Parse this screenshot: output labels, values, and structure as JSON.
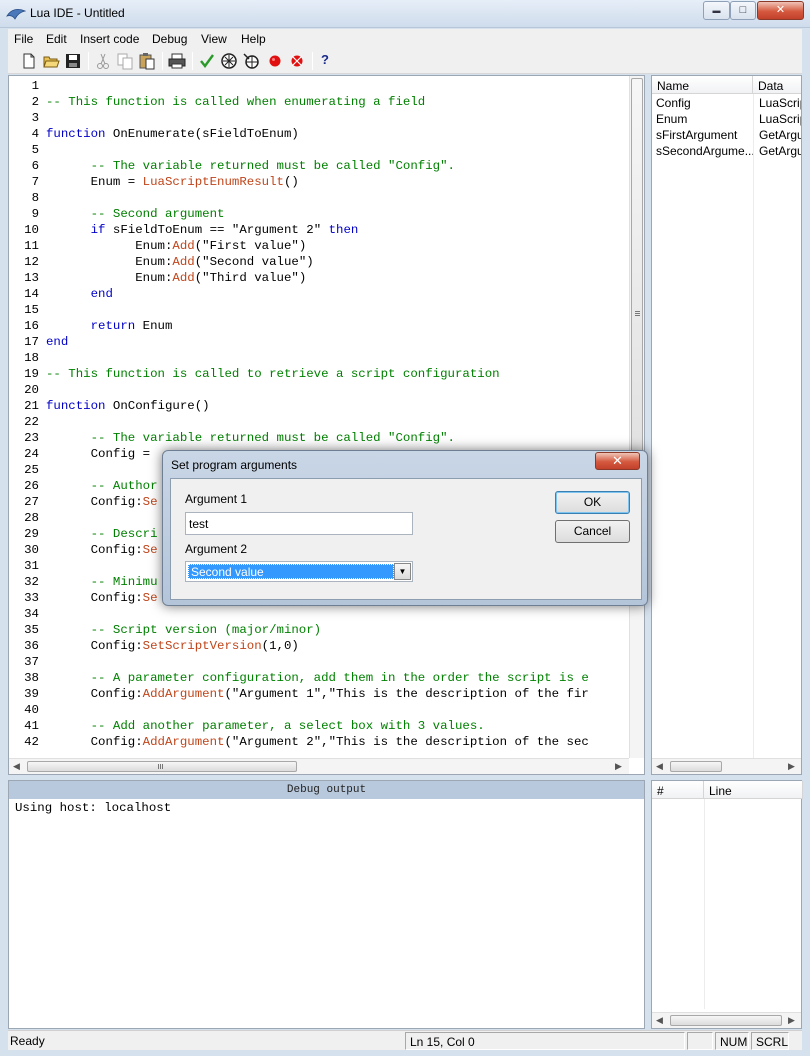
{
  "window": {
    "title": "Lua IDE - Untitled",
    "minimize_glyph": "▬",
    "maximize_glyph": "□",
    "close_glyph": "✕"
  },
  "menu": [
    "File",
    "Edit",
    "Insert code",
    "Debug",
    "View",
    "Help"
  ],
  "toolbar": {
    "icons": [
      "new-file-icon",
      "open-folder-icon",
      "save-icon",
      "cut-icon",
      "copy-icon",
      "paste-icon",
      "print-icon",
      "check-syntax-icon",
      "run-icon",
      "step-icon",
      "breakpoint-icon",
      "clear-breakpoints-icon",
      "help-icon"
    ],
    "help_glyph": "?"
  },
  "editor": {
    "lines": [
      {
        "n": "1",
        "text": "",
        "tokens": []
      },
      {
        "n": "2",
        "tokens": [
          [
            "-- This function is called when enumerating a field",
            "cm"
          ]
        ]
      },
      {
        "n": "3",
        "tokens": []
      },
      {
        "n": "4",
        "tokens": [
          [
            "function",
            "kw"
          ],
          [
            " OnEnumerate(sFieldToEnum)",
            ""
          ]
        ]
      },
      {
        "n": "5",
        "tokens": []
      },
      {
        "n": "6",
        "tokens": [
          [
            "      -- The variable returned must be called \"Config\".",
            "cm"
          ]
        ]
      },
      {
        "n": "7",
        "tokens": [
          [
            "      Enum = ",
            ""
          ],
          [
            "LuaScriptEnumResult",
            "fn"
          ],
          [
            "()",
            ""
          ]
        ]
      },
      {
        "n": "8",
        "tokens": []
      },
      {
        "n": "9",
        "tokens": [
          [
            "      -- Second argument",
            "cm"
          ]
        ]
      },
      {
        "n": "10",
        "tokens": [
          [
            "      ",
            ""
          ],
          [
            "if",
            "kw"
          ],
          [
            " sFieldToEnum == \"Argument 2\" ",
            ""
          ],
          [
            "then",
            "kw"
          ]
        ]
      },
      {
        "n": "11",
        "tokens": [
          [
            "            Enum:",
            ""
          ],
          [
            "Add",
            "fn"
          ],
          [
            "(\"First value\")",
            ""
          ]
        ]
      },
      {
        "n": "12",
        "tokens": [
          [
            "            Enum:",
            ""
          ],
          [
            "Add",
            "fn"
          ],
          [
            "(\"Second value\")",
            ""
          ]
        ]
      },
      {
        "n": "13",
        "tokens": [
          [
            "            Enum:",
            ""
          ],
          [
            "Add",
            "fn"
          ],
          [
            "(\"Third value\")",
            ""
          ]
        ]
      },
      {
        "n": "14",
        "tokens": [
          [
            "      ",
            ""
          ],
          [
            "end",
            "kw"
          ]
        ]
      },
      {
        "n": "15",
        "tokens": []
      },
      {
        "n": "16",
        "tokens": [
          [
            "      ",
            ""
          ],
          [
            "return",
            "kw"
          ],
          [
            " Enum",
            ""
          ]
        ]
      },
      {
        "n": "17",
        "tokens": [
          [
            "end",
            "kw"
          ]
        ]
      },
      {
        "n": "18",
        "tokens": []
      },
      {
        "n": "19",
        "tokens": [
          [
            "-- This function is called to retrieve a script configuration",
            "cm"
          ]
        ]
      },
      {
        "n": "20",
        "tokens": []
      },
      {
        "n": "21",
        "tokens": [
          [
            "function",
            "kw"
          ],
          [
            " OnConfigure()",
            ""
          ]
        ]
      },
      {
        "n": "22",
        "tokens": []
      },
      {
        "n": "23",
        "tokens": [
          [
            "      -- The variable returned must be called \"Config\".",
            "cm"
          ]
        ]
      },
      {
        "n": "24",
        "tokens": [
          [
            "      Config = ",
            ""
          ]
        ]
      },
      {
        "n": "25",
        "tokens": []
      },
      {
        "n": "26",
        "tokens": [
          [
            "      -- Author",
            "cm"
          ]
        ]
      },
      {
        "n": "27",
        "tokens": [
          [
            "      Config:",
            ""
          ],
          [
            "Se",
            "fn"
          ]
        ]
      },
      {
        "n": "28",
        "tokens": []
      },
      {
        "n": "29",
        "tokens": [
          [
            "      -- Descri",
            "cm"
          ]
        ]
      },
      {
        "n": "30",
        "tokens": [
          [
            "      Config:",
            ""
          ],
          [
            "Se",
            "fn"
          ]
        ]
      },
      {
        "n": "31",
        "tokens": []
      },
      {
        "n": "32",
        "tokens": [
          [
            "      -- Minimu",
            "cm"
          ]
        ]
      },
      {
        "n": "33",
        "tokens": [
          [
            "      Config:",
            ""
          ],
          [
            "Se",
            "fn"
          ]
        ]
      },
      {
        "n": "34",
        "tokens": []
      },
      {
        "n": "35",
        "tokens": [
          [
            "      -- Script version (major/minor)",
            "cm"
          ]
        ]
      },
      {
        "n": "36",
        "tokens": [
          [
            "      Config:",
            ""
          ],
          [
            "SetScriptVersion",
            "fn"
          ],
          [
            "(1,0)",
            ""
          ]
        ]
      },
      {
        "n": "37",
        "tokens": []
      },
      {
        "n": "38",
        "tokens": [
          [
            "      -- A parameter configuration, add them in the order the script is e",
            "cm"
          ]
        ]
      },
      {
        "n": "39",
        "tokens": [
          [
            "      Config:",
            ""
          ],
          [
            "AddArgument",
            "fn"
          ],
          [
            "(\"Argument 1\",\"This is the description of the fir",
            ""
          ]
        ]
      },
      {
        "n": "40",
        "tokens": []
      },
      {
        "n": "41",
        "tokens": [
          [
            "      -- Add another parameter, a select box with 3 values.",
            "cm"
          ]
        ]
      },
      {
        "n": "42",
        "tokens": [
          [
            "      Config:",
            ""
          ],
          [
            "AddArgument",
            "fn"
          ],
          [
            "(\"Argument 2\",\"This is the description of the sec",
            ""
          ]
        ]
      }
    ]
  },
  "variables": {
    "col_name": "Name",
    "col_data": "Data",
    "rows": [
      {
        "name": "Config",
        "data": "LuaScriptConfig"
      },
      {
        "name": "Enum",
        "data": "LuaScriptEnumResult"
      },
      {
        "name": "sFirstArgument",
        "data": "GetArgument"
      },
      {
        "name": "sSecondArgume...",
        "data": "GetArgument"
      }
    ]
  },
  "debug": {
    "title": "Debug output",
    "text": "Using host: localhost"
  },
  "breakpoints": {
    "col_num": "#",
    "col_line": "Line"
  },
  "status": {
    "ready": "Ready",
    "position": "Ln 15, Col 0",
    "num": "NUM",
    "scrl": "SCRL"
  },
  "dialog": {
    "title": "Set program arguments",
    "arg1_label": "Argument 1",
    "arg1_value": "test",
    "arg2_label": "Argument 2",
    "arg2_value": "Second value",
    "ok": "OK",
    "cancel": "Cancel",
    "close_glyph": "✕"
  },
  "colors": {
    "keyword": "#0000c8",
    "comment": "#008000",
    "function": "#c0451a",
    "selection": "#3399ff"
  }
}
